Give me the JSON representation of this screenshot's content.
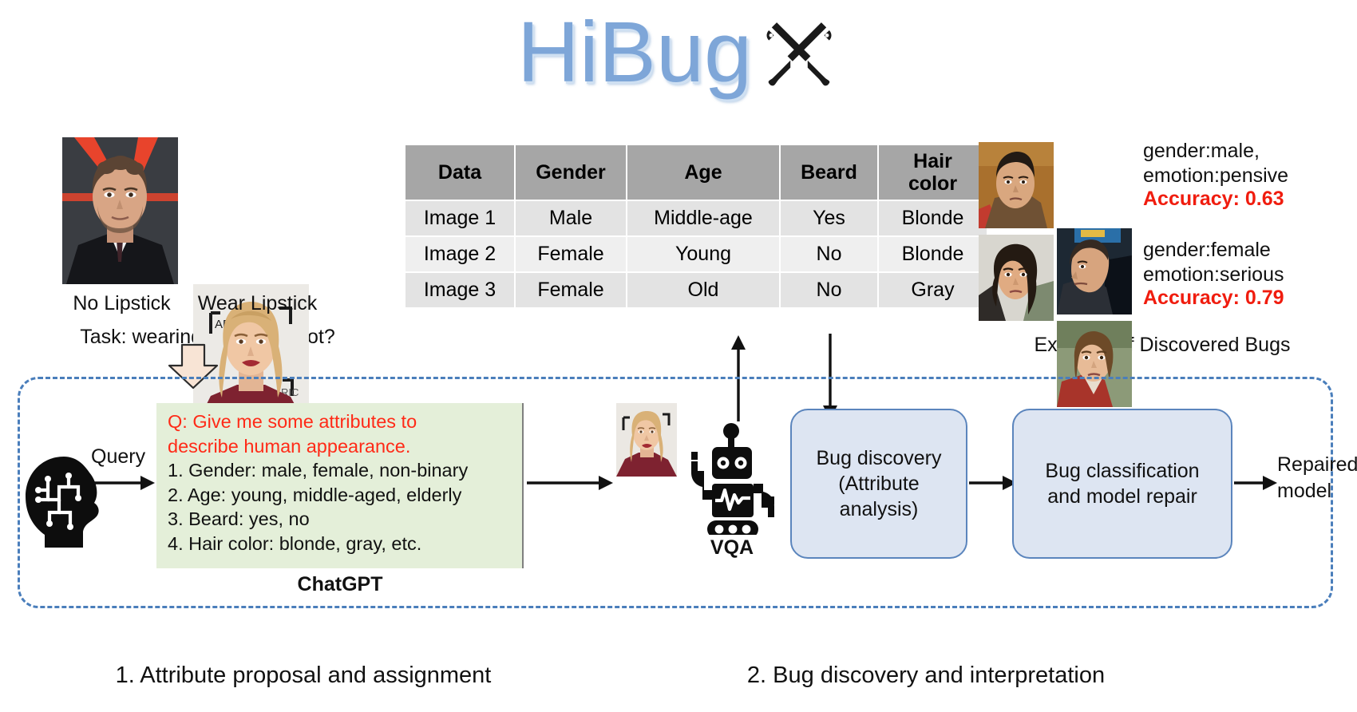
{
  "title": {
    "text": "HiBug",
    "icon": "tools-icon",
    "color": "#7EA6D8"
  },
  "task_panel": {
    "samples": [
      {
        "caption": "No Lipstick",
        "image": "male-face-photo"
      },
      {
        "caption": "Wear Lipstick",
        "image": "female-face-photo"
      }
    ],
    "task_text": "Task: wearing lipstick or not?",
    "down_arrow": "down-arrow-icon"
  },
  "attribute_table": {
    "headers": [
      "Data",
      "Gender",
      "Age",
      "Beard",
      "Hair color"
    ],
    "rows": [
      [
        "Image 1",
        "Male",
        "Middle-age",
        "Yes",
        "Blonde"
      ],
      [
        "Image 2",
        "Female",
        "Young",
        "No",
        "Blonde"
      ],
      [
        "Image 3",
        "Female",
        "Old",
        "No",
        "Gray"
      ]
    ]
  },
  "bug_examples": {
    "caption": "Example of Discovered Bugs",
    "accent_color": "#f01c0e",
    "items": [
      {
        "line1": "gender:male,",
        "line2": "emotion:pensive",
        "accuracy": "Accuracy: 0.63",
        "thumbs": [
          "bug-face-1",
          "bug-face-2"
        ]
      },
      {
        "line1": "gender:female",
        "line2": "emotion:serious",
        "accuracy": "Accuracy: 0.79",
        "thumbs": [
          "bug-face-3",
          "bug-face-4"
        ]
      }
    ]
  },
  "pipeline": {
    "query_label": "Query",
    "brain_icon": "brain-icon",
    "chatgpt": {
      "label": "ChatGPT",
      "question": [
        "Q: Give me some attributes to",
        "describe human appearance."
      ],
      "answers": [
        "1. Gender: male, female, non-binary",
        "2. Age: young, middle-aged, elderly",
        "3. Beard: yes, no",
        "4. Hair color: blonde, gray, etc."
      ],
      "question_color": "#ff2a17"
    },
    "vqa": {
      "label": "VQA",
      "icon": "robot-icon",
      "input_image": "female-face-photo"
    },
    "boxes": [
      {
        "line1": "Bug discovery",
        "line2": "(Attribute",
        "line3": "analysis)"
      },
      {
        "line1": "Bug classification",
        "line2": "and model repair",
        "line3": ""
      }
    ],
    "output": {
      "line1": "Repaired",
      "line2": "model"
    }
  },
  "bottom_captions": {
    "left": "1. Attribute proposal and assignment",
    "right": "2. Bug discovery and interpretation"
  }
}
